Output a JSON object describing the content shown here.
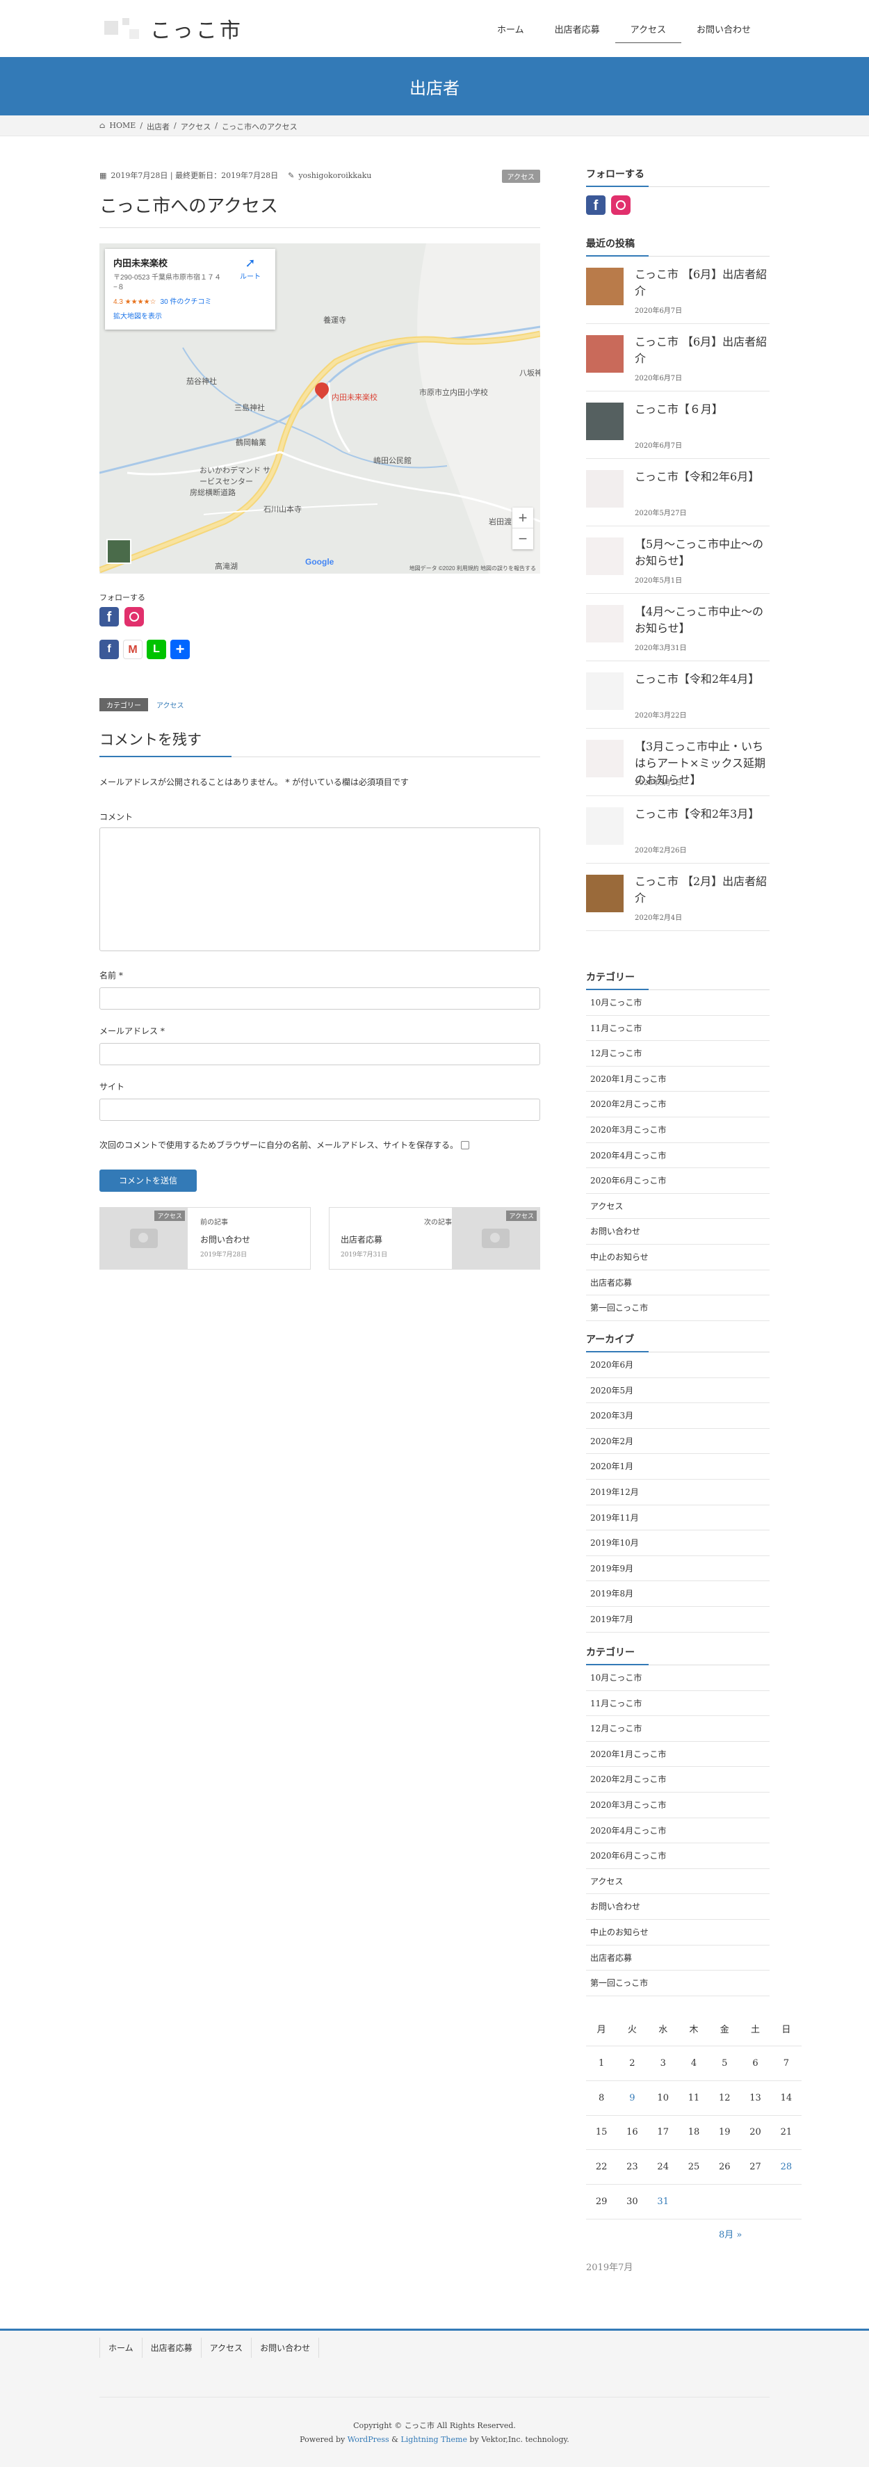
{
  "site": {
    "title": "こっこ市"
  },
  "nav": [
    "ホーム",
    "出店者応募",
    "アクセス",
    "お問い合わせ"
  ],
  "page_header": "出店者",
  "breadcrumb": [
    "HOME",
    "出店者",
    "アクセス",
    "こっこ市へのアクセス"
  ],
  "post": {
    "meta": "2019年7月28日 | 最終更新日：2019年7月28日",
    "author": "yoshigokoroikkaku",
    "category_tag": "アクセス",
    "title": "こっこ市へのアクセス"
  },
  "map": {
    "card_name": "内田未来楽校",
    "card_address": "〒290-0523 千葉県市原市宿１７４−８",
    "card_rating": "4.3 ★★★★☆",
    "card_reviews": "30 件のクチコミ",
    "card_larger": "拡大地図を表示",
    "card_route": "ルート",
    "pin_label": "内田未来楽校",
    "labels": [
      "養運寺",
      "市原市立内田小学校",
      "三島神社",
      "鶴岡輪業",
      "おいかわデマンド サービスセンター",
      "嶋田公民館",
      "石川山本寺",
      "高滝湖",
      "茄谷神社",
      "八坂神社",
      "岩田渡し",
      "房総横断道路"
    ],
    "footer": "地図データ ©2020  利用規約  地図の誤りを報告する",
    "google": "Google",
    "zoom_in": "+",
    "zoom_out": "−"
  },
  "follow": {
    "title": "フォローする"
  },
  "share": {
    "fb": "f",
    "gm": "M",
    "line": "L",
    "plus": "+"
  },
  "entry_meta": {
    "label": "カテゴリー",
    "value": "アクセス"
  },
  "comment": {
    "title": "コメントを残す",
    "note": "メールアドレスが公開されることはありません。 * が付いている欄は必須項目です",
    "comment_label": "コメント",
    "name_label": "名前 *",
    "email_label": "メールアドレス *",
    "site_label": "サイト",
    "cookie": "次回のコメントで使用するためブラウザーに自分の名前、メールアドレス、サイトを保存する。",
    "submit": "コメントを送信"
  },
  "prev_next": {
    "prev": {
      "kind": "前の記事",
      "title": "お問い合わせ",
      "date": "2019年7月28日",
      "tag": "アクセス"
    },
    "next": {
      "kind": "次の記事",
      "title": "出店者応募",
      "date": "2019年7月31日",
      "tag": "アクセス"
    }
  },
  "sidebar": {
    "follow_title": "フォローする",
    "recent_title": "最近の投稿",
    "recent": [
      {
        "title": "こっこ市 【6月】出店者紹介",
        "date": "2020年6月7日",
        "color": "#b97b4a"
      },
      {
        "title": "こっこ市 【6月】出店者紹介",
        "date": "2020年6月7日",
        "color": "#c96a5a"
      },
      {
        "title": "こっこ市【６月】",
        "date": "2020年6月7日",
        "color": "#556060"
      },
      {
        "title": "こっこ市【令和2年6月】",
        "date": "2020年5月27日",
        "color": "#f2eeee"
      },
      {
        "title": "【5月〜こっこ市中止〜のお知らせ】",
        "date": "2020年5月1日",
        "color": "#f4f0f0"
      },
      {
        "title": "【4月〜こっこ市中止〜のお知らせ】",
        "date": "2020年3月31日",
        "color": "#f4f0f0"
      },
      {
        "title": "こっこ市【令和2年4月】",
        "date": "2020年3月22日",
        "color": "#f4f4f4"
      },
      {
        "title": "【3月こっこ市中止・いちはらアート×ミックス延期のお知らせ】",
        "date": "2020年3月3日",
        "color": "#f4f0f0"
      },
      {
        "title": "こっこ市【令和2年3月】",
        "date": "2020年2月26日",
        "color": "#f4f4f4"
      },
      {
        "title": "こっこ市 【2月】出店者紹介",
        "date": "2020年2月4日",
        "color": "#9a6a3a"
      }
    ],
    "cat_title": "カテゴリー",
    "categories": [
      "10月こっこ市",
      "11月こっこ市",
      "12月こっこ市",
      "2020年1月こっこ市",
      "2020年2月こっこ市",
      "2020年3月こっこ市",
      "2020年4月こっこ市",
      "2020年6月こっこ市",
      "アクセス",
      "お問い合わせ",
      "中止のお知らせ",
      "出店者応募",
      "第一回こっこ市"
    ],
    "archive_title": "アーカイブ",
    "archives": [
      "2020年6月",
      "2020年5月",
      "2020年3月",
      "2020年2月",
      "2020年1月",
      "2019年12月",
      "2019年11月",
      "2019年10月",
      "2019年9月",
      "2019年8月",
      "2019年7月"
    ],
    "cat_title2": "カテゴリー",
    "categories2": [
      "10月こっこ市",
      "11月こっこ市",
      "12月こっこ市",
      "2020年1月こっこ市",
      "2020年2月こっこ市",
      "2020年3月こっこ市",
      "2020年4月こっこ市",
      "2020年6月こっこ市",
      "アクセス",
      "お問い合わせ",
      "中止のお知らせ",
      "出店者応募",
      "第一回こっこ市"
    ]
  },
  "calendar": {
    "days": [
      "月",
      "火",
      "水",
      "木",
      "金",
      "土",
      "日"
    ],
    "weeks": [
      [
        "1",
        "2",
        "3",
        "4",
        "5",
        "6",
        "7"
      ],
      [
        "8",
        "9",
        "10",
        "11",
        "12",
        "13",
        "14"
      ],
      [
        "15",
        "16",
        "17",
        "18",
        "19",
        "20",
        "21"
      ],
      [
        "22",
        "23",
        "24",
        "25",
        "26",
        "27",
        "28"
      ],
      [
        "29",
        "30",
        "31",
        "",
        "",
        "",
        ""
      ]
    ],
    "linked": [
      "9",
      "28",
      "31"
    ],
    "next": "8月 »",
    "caption": "2019年7月"
  },
  "footer": {
    "nav": [
      "ホーム",
      "出店者応募",
      "アクセス",
      "お問い合わせ"
    ],
    "copyright": "Copyright © こっこ市 All Rights Reserved.",
    "powered_pre": "Powered by ",
    "wordpress": "WordPress",
    "amp": " & ",
    "lightning": "Lightning Theme",
    "powered_post": " by Vektor,Inc. technology."
  }
}
